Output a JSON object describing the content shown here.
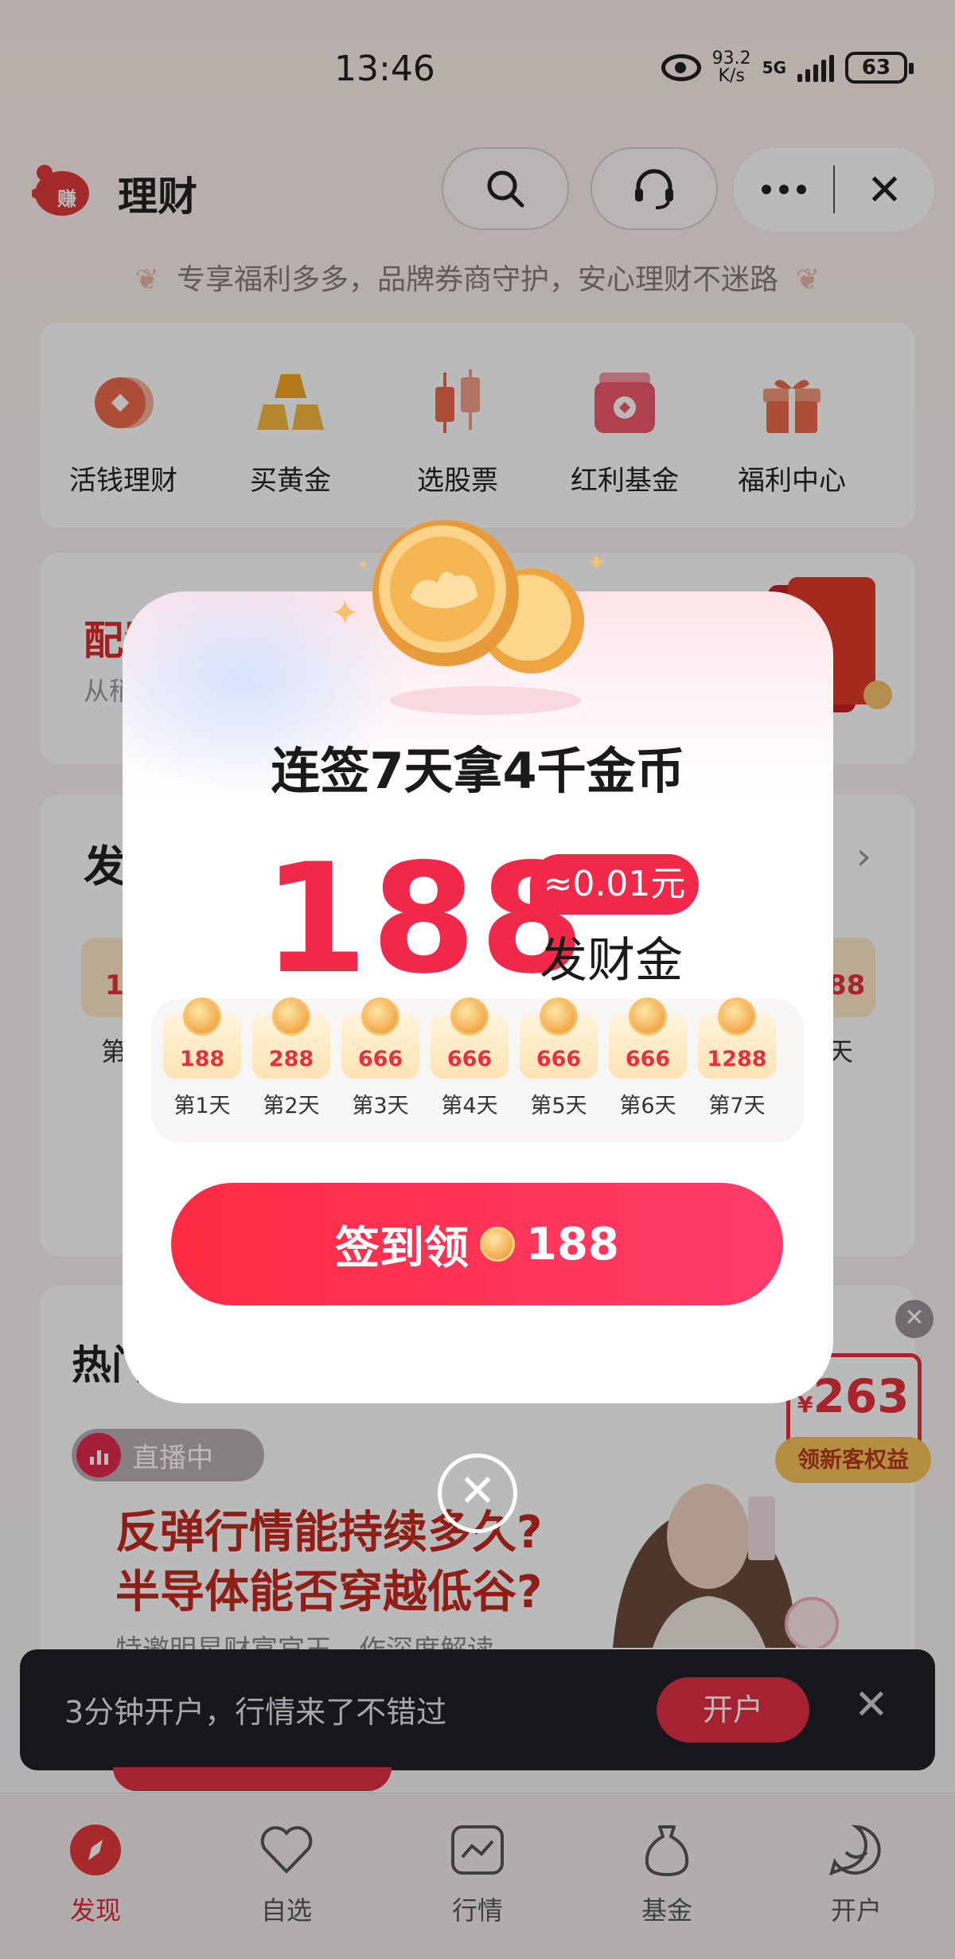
{
  "status": {
    "time": "13:46",
    "speed_top": "93.2",
    "speed_unit": "K/s",
    "network": "5G",
    "battery": "63"
  },
  "header": {
    "title": "理财",
    "logo_text": "赚"
  },
  "slogan": "专享福利多多，品牌券商守护，安心理财不迷路",
  "nav": [
    {
      "label": "活钱理财",
      "icon": "coin-stack-icon"
    },
    {
      "label": "买黄金",
      "icon": "gold-bars-icon"
    },
    {
      "label": "选股票",
      "icon": "candlestick-icon"
    },
    {
      "label": "红利基金",
      "icon": "fund-box-icon"
    },
    {
      "label": "福利中心",
      "icon": "gift-icon"
    }
  ],
  "promo": {
    "title_partial": "配置",
    "sub_partial": "从稍"
  },
  "checkin_card": {
    "title_partial": "发",
    "day_left": "第",
    "day_right": "天",
    "val_left": "1",
    "val_right": "88"
  },
  "hot": {
    "title_partial": "热门",
    "live_label": "直播中",
    "headline1": "反弹行情能持续多久?",
    "headline2": "半导体能否穿越低谷?",
    "subline": "特邀明星财富官王…作深度解读"
  },
  "badge": {
    "currency": "¥",
    "amount": "263",
    "tag": "领新客权益"
  },
  "bottom_bar": {
    "text": "3分钟开户，行情来了不错过",
    "button": "开户"
  },
  "tabs": [
    {
      "label": "发现",
      "icon": "compass-icon",
      "active": true
    },
    {
      "label": "自选",
      "icon": "heart-icon",
      "active": false
    },
    {
      "label": "行情",
      "icon": "chart-line-icon",
      "active": false
    },
    {
      "label": "基金",
      "icon": "money-bag-icon",
      "active": false
    },
    {
      "label": "开户",
      "icon": "smile-chat-icon",
      "active": false
    }
  ],
  "modal": {
    "title": "连签7天拿4千金币",
    "amount": "188",
    "approx": "≈0.01元",
    "unit": "发财金",
    "days": [
      {
        "value": "188",
        "label": "第1天"
      },
      {
        "value": "288",
        "label": "第2天"
      },
      {
        "value": "666",
        "label": "第3天"
      },
      {
        "value": "666",
        "label": "第4天"
      },
      {
        "value": "666",
        "label": "第5天"
      },
      {
        "value": "666",
        "label": "第6天"
      },
      {
        "value": "1288",
        "label": "第7天"
      }
    ],
    "button_text": "签到领",
    "button_amount": "188"
  },
  "colors": {
    "accent": "#f0294a",
    "brand_red": "#e02a3a",
    "gold": "#f2a94a"
  }
}
